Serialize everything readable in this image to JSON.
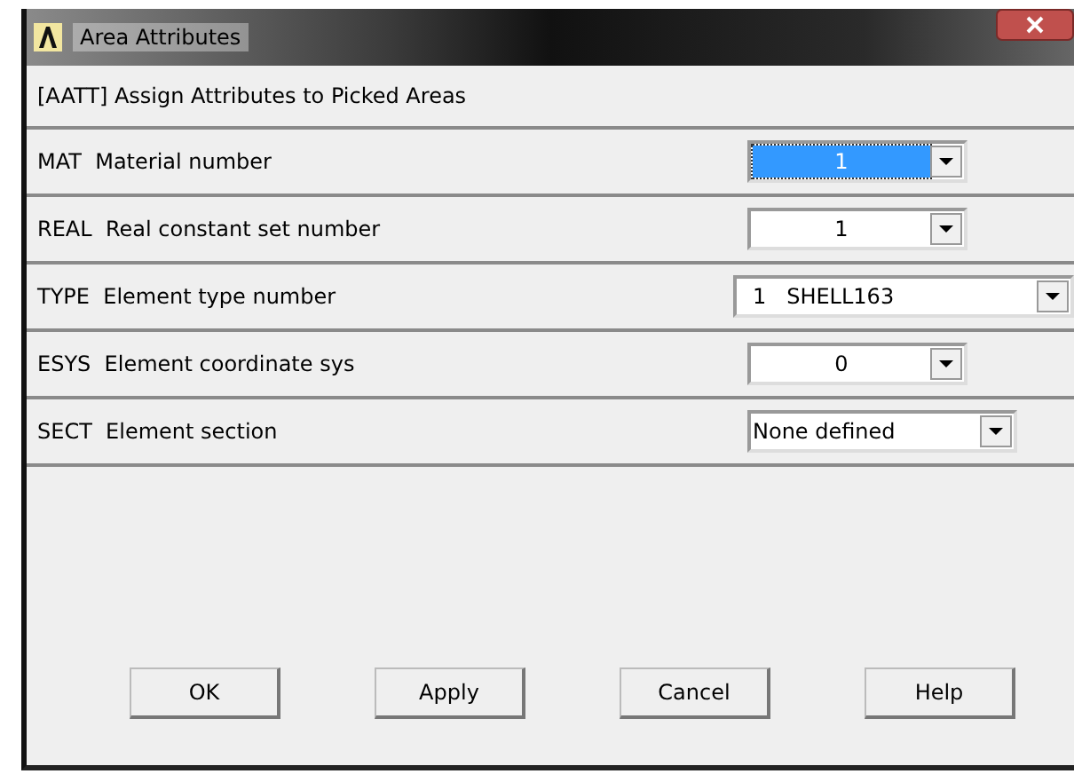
{
  "window": {
    "title": "Area Attributes"
  },
  "header": "[AATT] Assign Attributes to Picked Areas",
  "fields": [
    {
      "label": "MAT  Material number",
      "value": "1",
      "selected": true
    },
    {
      "label": "REAL  Real constant set number",
      "value": "1",
      "selected": false
    },
    {
      "label": "TYPE  Element type number",
      "value": "1   SHELL163",
      "selected": false
    },
    {
      "label": "ESYS  Element coordinate sys",
      "value": "0",
      "selected": false
    },
    {
      "label": "SECT  Element section",
      "value": "None defined",
      "selected": false
    }
  ],
  "buttons": [
    "OK",
    "Apply",
    "Cancel",
    "Help"
  ]
}
